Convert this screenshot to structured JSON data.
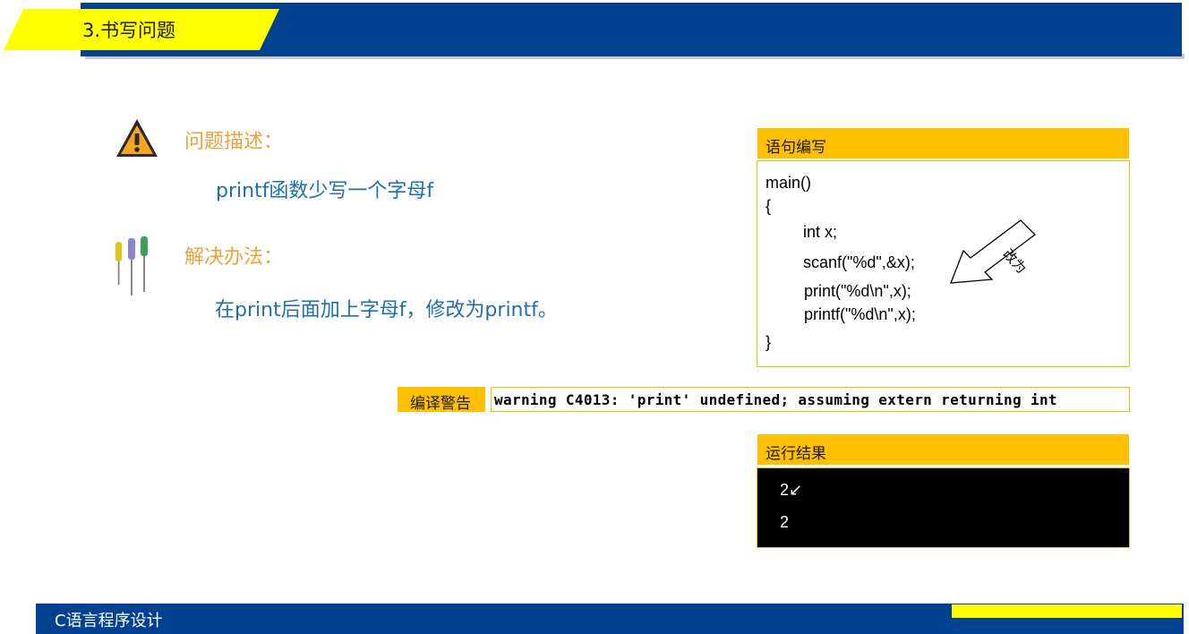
{
  "header": {
    "title": "3.书写问题"
  },
  "problem": {
    "heading": "问题描述：",
    "description": "printf函数少写一个字母f"
  },
  "solution": {
    "heading": "解决办法：",
    "description": "在print后面加上字母f，修改为printf。"
  },
  "code_panel": {
    "title": "语句编写",
    "lines": [
      "main()",
      "{",
      "int x;",
      "scanf(\"%d\",&x);",
      "print(\"%d\\n\",x);",
      "printf(\"%d\\n\",x);",
      "}"
    ],
    "arrow_label": "改为"
  },
  "compile_warning": {
    "label": "编译警告",
    "message": "warning C4013: 'print' undefined; assuming extern returning int"
  },
  "run_result": {
    "title": "运行结果",
    "lines": [
      "2↙",
      "2"
    ]
  },
  "footer": {
    "course": "C语言程序设计"
  },
  "colors": {
    "navy": "#00428f",
    "yellow": "#ffff00",
    "gold": "#ffc000",
    "orange_heading": "#e8a33a",
    "blue_text": "#1f6fb0"
  }
}
